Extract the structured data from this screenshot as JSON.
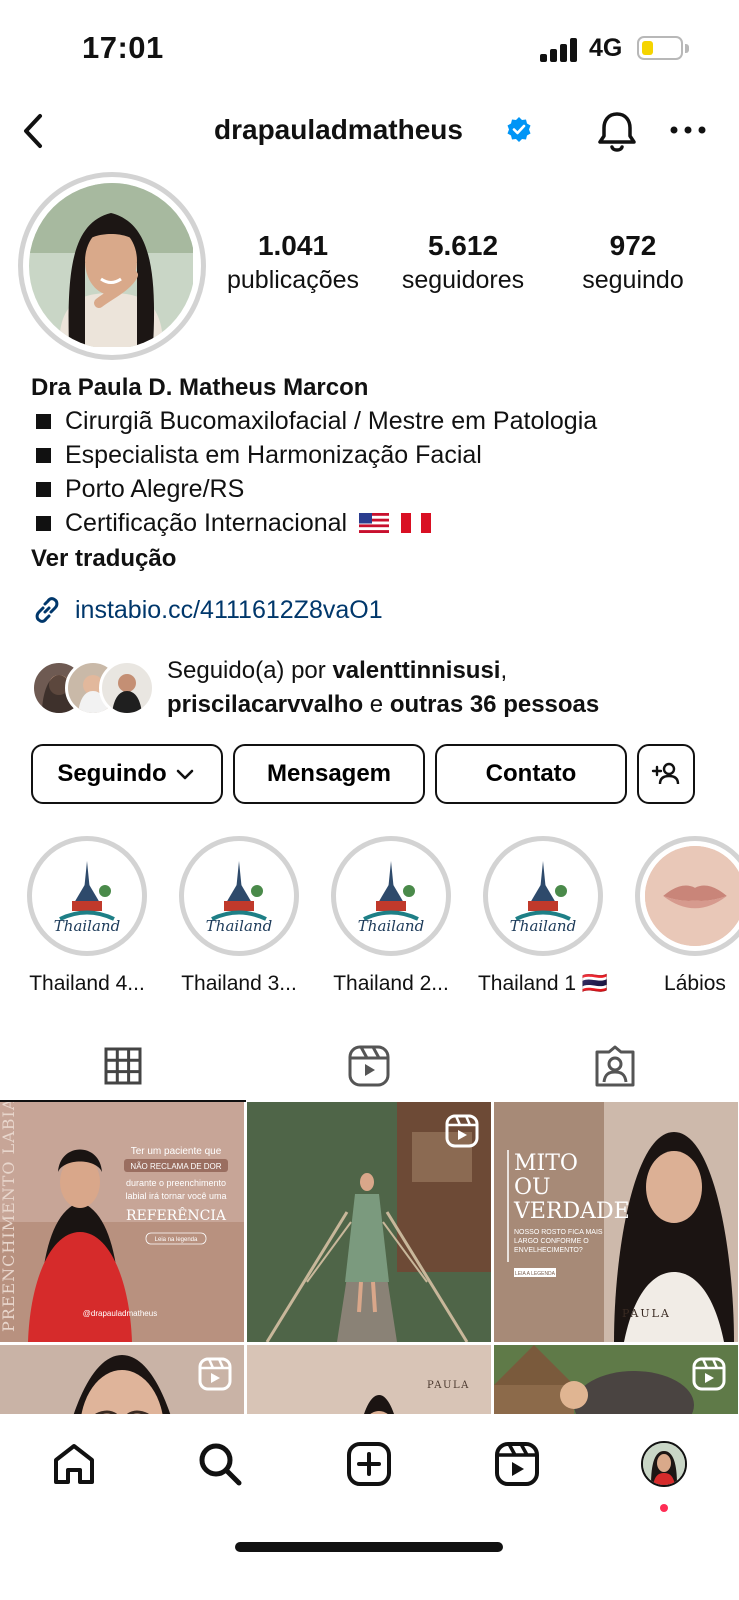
{
  "status_bar": {
    "time": "17:01",
    "network": "4G",
    "battery_level": 0.25
  },
  "header": {
    "username": "drapauladmatheus",
    "verified": true
  },
  "stats": [
    {
      "number": "1.041",
      "label": "publicações"
    },
    {
      "number": "5.612",
      "label": "seguidores"
    },
    {
      "number": "972",
      "label": "seguindo"
    }
  ],
  "bio": {
    "name": "Dra Paula D. Matheus Marcon",
    "lines": [
      "Cirurgiã Bucomaxilofacial / Mestre em Patologia",
      "Especialista em Harmonização Facial",
      "Porto Alegre/RS",
      "Certificação Internacional"
    ],
    "translate": "Ver tradução",
    "link": "instabio.cc/4111612Z8vaO1"
  },
  "followed_by": {
    "prefix": "Seguido(a) por ",
    "user1": "valenttinnisusi",
    "comma": ",",
    "user2": "priscilacarvvalho",
    "and": " e ",
    "others": "outras 36 pessoas"
  },
  "actions": {
    "following": "Seguindo",
    "message": "Mensagem",
    "contact": "Contato"
  },
  "highlights": [
    {
      "label": "Thailand 4..."
    },
    {
      "label": "Thailand 3..."
    },
    {
      "label": "Thailand 2..."
    },
    {
      "label": "Thailand 1 🇹🇭"
    },
    {
      "label": "Lábios"
    }
  ],
  "posts": {
    "post1": {
      "side_text": "PREENCHIMENTO LABIAL",
      "line1": "Ter um paciente que",
      "line2": "NÃO RECLAMA DE DOR",
      "line3": "durante o preenchimento",
      "line4": "labial irá tornar você uma",
      "line5": "REFERÊNCIA",
      "line6": "Leia na legenda",
      "handle": "@drapauladmatheus"
    },
    "post3": {
      "title1": "MITO",
      "title2": "OU",
      "title3": "VERDADE",
      "sub1": "NOSSO ROSTO FICA MAIS",
      "sub2": "LARGO CONFORME O",
      "sub3": "ENVELHECIMENTO?",
      "cta": "LEIA A LEGENDA",
      "brand": "PAULA"
    },
    "post5": {
      "brand": "PAULA"
    }
  },
  "colors": {
    "link": "#00376b",
    "verified": "#0095f6",
    "notification_dot": "#ff2d55"
  }
}
